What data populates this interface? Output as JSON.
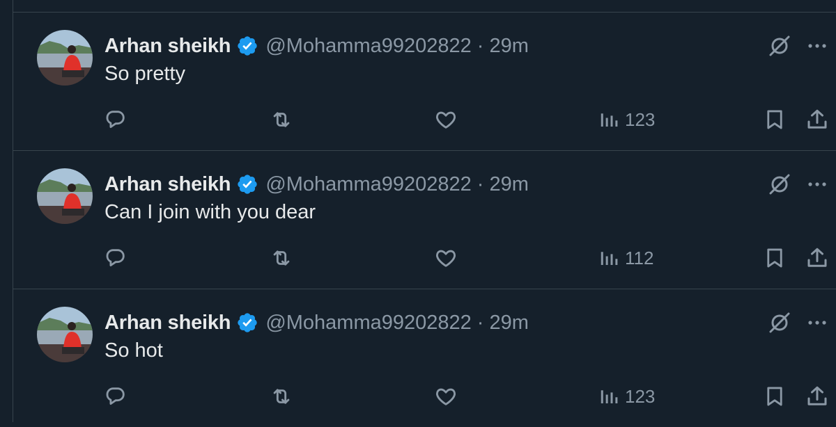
{
  "colors": {
    "background": "#15202b",
    "border": "#38444d",
    "text_primary": "#e7e9ea",
    "text_secondary": "#8b98a5",
    "verified_badge": "#1d9bf0"
  },
  "replies": [
    {
      "author": {
        "display_name": "Arhan sheikh",
        "handle": "@Mohamma99202822",
        "verified": true
      },
      "separator": "·",
      "time": "29m",
      "text": "So pretty",
      "views": "123"
    },
    {
      "author": {
        "display_name": "Arhan sheikh",
        "handle": "@Mohamma99202822",
        "verified": true
      },
      "separator": "·",
      "time": "29m",
      "text": "Can I join with you dear",
      "views": "112"
    },
    {
      "author": {
        "display_name": "Arhan sheikh",
        "handle": "@Mohamma99202822",
        "verified": true
      },
      "separator": "·",
      "time": "29m",
      "text": "So hot",
      "views": "123"
    }
  ],
  "icons": {
    "avatar": "profile-photo",
    "verified": "verified-badge-icon",
    "grok": "grok-icon",
    "more": "more-icon",
    "reply": "reply-icon",
    "repost": "repost-icon",
    "like": "heart-icon",
    "views": "views-chart-icon",
    "bookmark": "bookmark-icon",
    "share": "share-icon"
  }
}
